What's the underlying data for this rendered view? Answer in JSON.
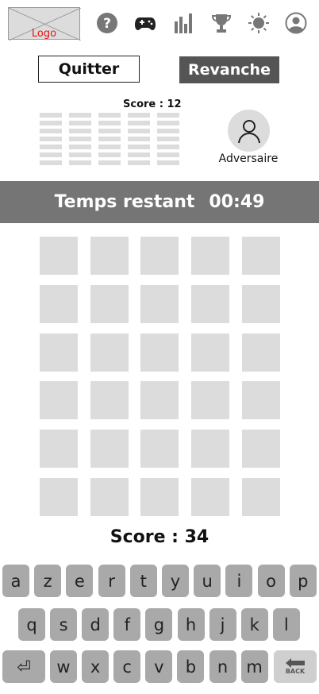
{
  "header": {
    "logo_text": "Logo",
    "nav_icons": [
      "help-icon",
      "gamepad-icon",
      "stats-icon",
      "trophy-icon",
      "brightness-icon",
      "profile-icon"
    ]
  },
  "actions": {
    "quit_label": "Quitter",
    "rematch_label": "Revanche"
  },
  "opponent": {
    "score_text": "Score : 12",
    "name": "Adversaire"
  },
  "timer": {
    "label": "Temps restant",
    "value": "00:49"
  },
  "board": {
    "rows": 6,
    "cols": 5
  },
  "player": {
    "score_text": "Score : 34"
  },
  "keyboard": {
    "row1": [
      "a",
      "z",
      "e",
      "r",
      "t",
      "y",
      "u",
      "i",
      "o",
      "p"
    ],
    "row2": [
      "q",
      "s",
      "d",
      "f",
      "g",
      "h",
      "j",
      "k",
      "l"
    ],
    "row3": [
      "w",
      "x",
      "c",
      "v",
      "b",
      "n",
      "m"
    ],
    "enter_symbol": "⏎",
    "back_label": "BACK"
  },
  "colors": {
    "accent_dark": "#555555",
    "timer_bg": "#757575",
    "cell": "#dcdcdc",
    "key": "#a9a9a9",
    "logo_text": "#e0191b"
  }
}
